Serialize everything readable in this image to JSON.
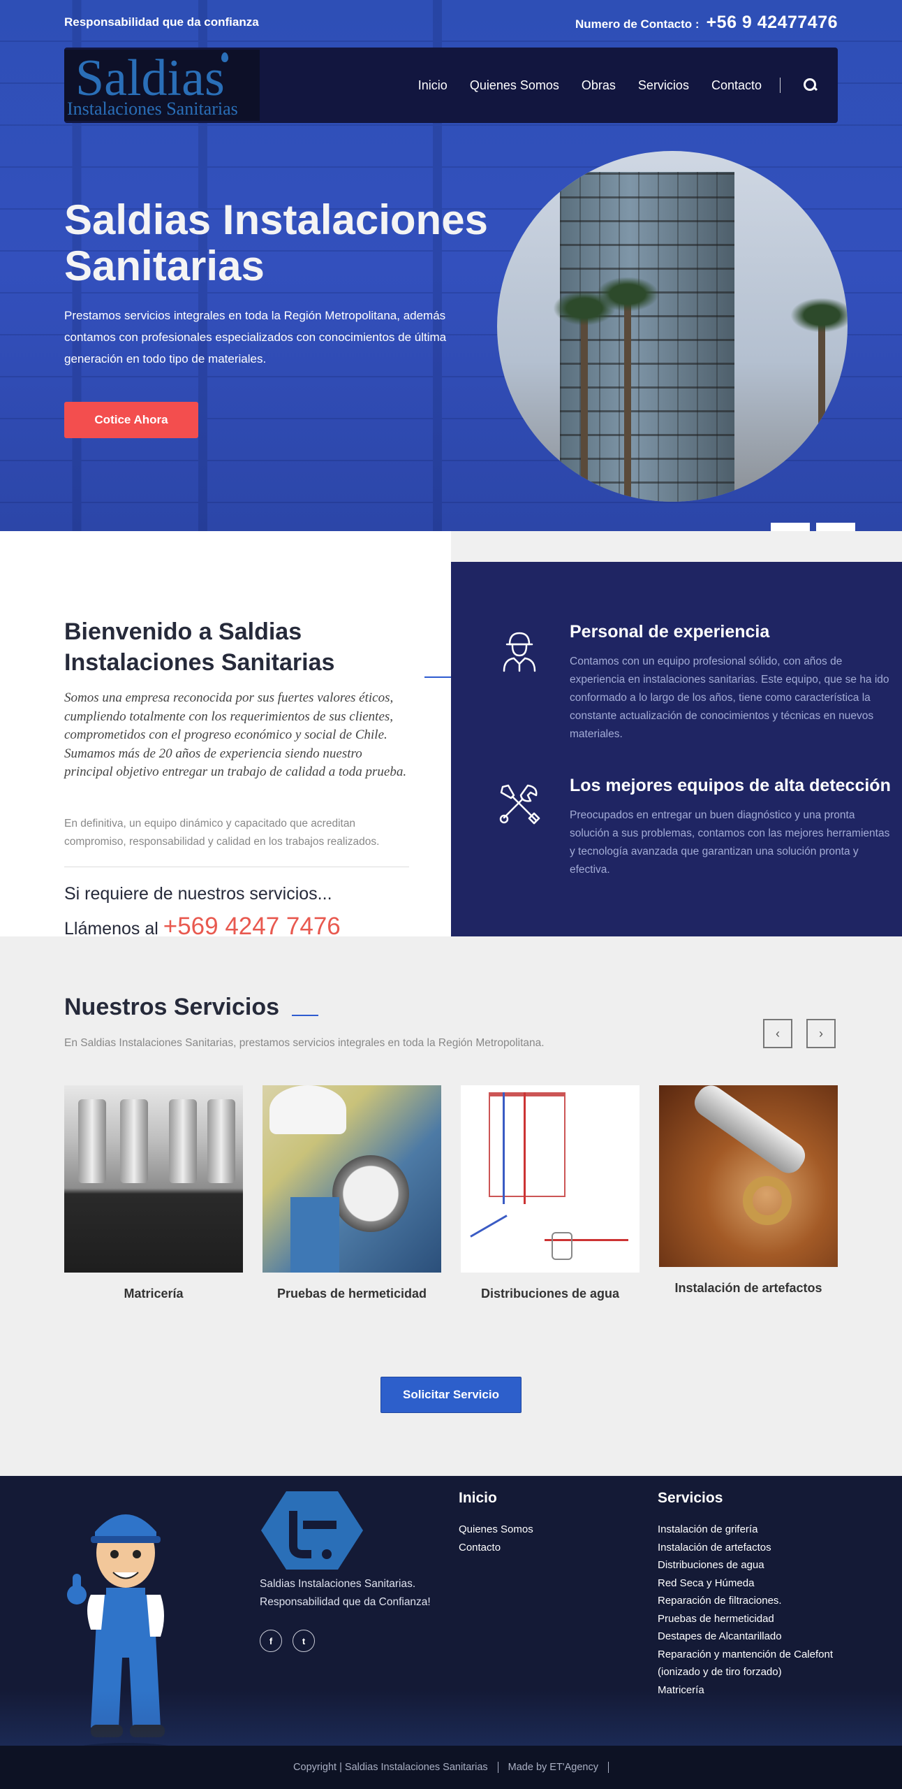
{
  "topbar": {
    "tagline": "Responsabilidad que da confianza",
    "contact_label": "Numero de Contacto :",
    "contact_phone": "+56 9 42477476"
  },
  "logo": {
    "big": "Saldias",
    "small": "Instalaciones Sanitarias"
  },
  "nav": {
    "items": [
      "Inicio",
      "Quienes Somos",
      "Obras",
      "Servicios",
      "Contacto"
    ]
  },
  "hero": {
    "title": "Saldias Instalaciones Sanitarias",
    "text": "Prestamos servicios integrales en toda la Región Metropolitana, además contamos con profesionales especializados con conocimientos de última generación en todo tipo de materiales.",
    "cta": "Cotice Ahora"
  },
  "welcome": {
    "title": "Bienvenido a Saldias Instalaciones Sanitarias",
    "italic": "Somos una empresa reconocida por sus fuertes valores éticos, cumpliendo totalmente con los requerimientos de sus clientes, comprometidos con el progreso económico y social de Chile. Sumamos más de 20 años de experiencia siendo nuestro principal objetivo entregar un trabajo de calidad a toda prueba.",
    "plain": "En definitiva, un equipo dinámico y capacitado que acreditan compromiso, responsabilidad y calidad en los trabajos realizados.",
    "request": "Si requiere de nuestros servicios...",
    "call_prefix": "Llámenos al",
    "call_number": "+569 4247 7476"
  },
  "features": [
    {
      "icon": "worker-icon",
      "title": "Personal de experiencia",
      "text": "Contamos con un equipo profesional sólido, con años de experiencia en instalaciones sanitarias. Este equipo, que se ha ido conformado a lo largo de los años, tiene como característica la constante actualización de conocimientos y técnicas en nuevos materiales."
    },
    {
      "icon": "tools-icon",
      "title": "Los mejores equipos de alta detección",
      "text": "Preocupados en entregar un buen diagnóstico y una pronta solución a sus problemas, contamos con las mejores herramientas y tecnología avanzada que garantizan una solución pronta y efectiva."
    }
  ],
  "services": {
    "title": "Nuestros Servicios",
    "subtitle": "En Saldias Instalaciones Sanitarias, prestamos servicios integrales en toda la Región Metropolitana.",
    "cards": [
      "Matricería",
      "Pruebas de hermeticidad",
      "Distribuciones de agua",
      "Instalación de artefactos"
    ],
    "button": "Solicitar Servicio"
  },
  "footer": {
    "desc_line1": "Saldias Instalaciones Sanitarias.",
    "desc_line2": "Responsabilidad que da Confianza!",
    "social": [
      "f",
      "t"
    ],
    "col1": {
      "title": "Inicio",
      "links": [
        "Quienes Somos",
        "Contacto"
      ]
    },
    "col2": {
      "title": "Servicios",
      "links": [
        "Instalación de grifería",
        "Instalación de artefactos",
        "Distribuciones de agua",
        "Red Seca y Húmeda",
        "Reparación de filtraciones.",
        "Pruebas de hermeticidad",
        "Destapes de Alcantarillado",
        "Reparación y mantención de Calefont (ionizado y de tiro forzado)",
        "Matricería"
      ]
    },
    "copyright": "Copyright | Saldias Instalaciones Sanitarias",
    "made_by": "Made by ET'Agency"
  },
  "colors": {
    "accent": "#f34e4e",
    "primary": "#2d5fcb",
    "navy": "#1f2563"
  }
}
